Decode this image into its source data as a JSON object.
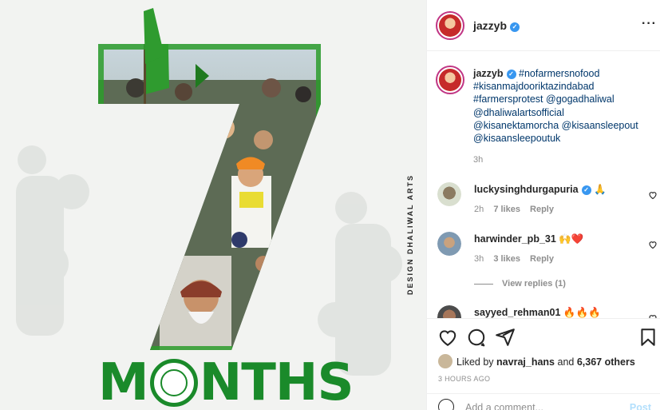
{
  "post": {
    "image": {
      "credit_text": "DESIGN DHALIWAL ARTS",
      "headline_letters": [
        "M",
        "N",
        "T",
        "H",
        "S"
      ],
      "headline": "MONTHS"
    }
  },
  "header": {
    "username": "jazzyb",
    "verified": true,
    "more_icon": "more-dots-icon"
  },
  "caption": {
    "username": "jazzyb",
    "text_lines": [
      "#nofarmersnofood",
      "#kisanmajdooriktazindabad",
      "#farmersprotest @gogadhaliwal",
      "@dhaliwalartsofficial",
      "@kisanektamorcha @kisaansleepout",
      "@kisaansleepoutuk"
    ],
    "time": "3h"
  },
  "comments": [
    {
      "username": "luckysinghdurgapuria",
      "verified": true,
      "text": "🙏",
      "time": "2h",
      "likes": "7 likes",
      "reply": "Reply",
      "avatar_color": "#b7bfa9"
    },
    {
      "username": "harwinder_pb_31",
      "verified": false,
      "text": "🙌❤️",
      "time": "3h",
      "likes": "3 likes",
      "reply": "Reply",
      "avatar_color": "#8aa3b8"
    }
  ],
  "view_replies": "View replies (1)",
  "partial_comment": {
    "username": "sayyed_rehman01",
    "text": "🔥🔥🔥"
  },
  "actions": {
    "like_icon": "heart-icon",
    "comment_icon": "comment-icon",
    "share_icon": "paper-plane-icon",
    "save_icon": "bookmark-icon"
  },
  "likes": {
    "prefix": "Liked by",
    "user": "navraj_hans",
    "and": "and",
    "others": "6,367 others"
  },
  "posted": "3 HOURS AGO",
  "add_comment": {
    "placeholder": "Add a comment...",
    "post_label": "Post"
  },
  "colors": {
    "link": "#00376b",
    "verified": "#3897f0",
    "muted": "#8e8e8e",
    "brand_green": "#1a8a2a"
  }
}
